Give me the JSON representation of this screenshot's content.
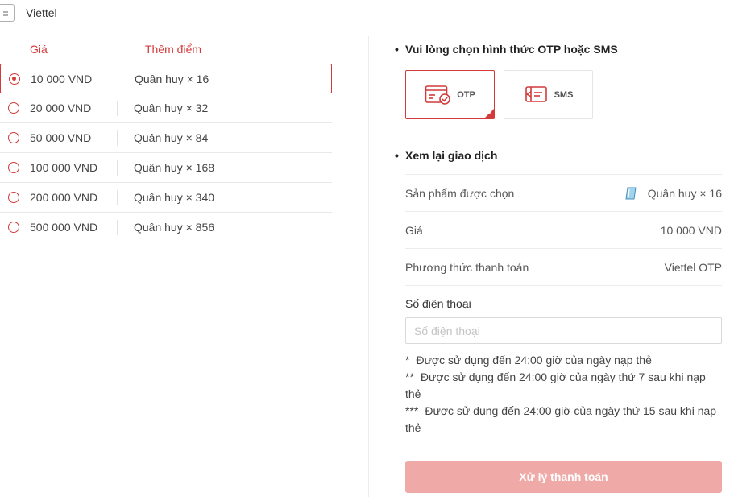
{
  "provider": {
    "name": "Viettel",
    "icon": "document-icon"
  },
  "columns": {
    "price": "Giá",
    "points": "Thêm điểm"
  },
  "options": [
    {
      "price": "10 000 VND",
      "points": "Quân huy × 16",
      "selected": true
    },
    {
      "price": "20 000 VND",
      "points": "Quân huy × 32",
      "selected": false
    },
    {
      "price": "50 000 VND",
      "points": "Quân huy × 84",
      "selected": false
    },
    {
      "price": "100 000 VND",
      "points": "Quân huy × 168",
      "selected": false
    },
    {
      "price": "200 000 VND",
      "points": "Quân huy × 340",
      "selected": false
    },
    {
      "price": "500 000 VND",
      "points": "Quân huy × 856",
      "selected": false
    }
  ],
  "otp_section": {
    "bullet": "•",
    "title": "Vui lòng chọn hình thức OTP hoặc SMS",
    "methods": [
      {
        "label": "OTP",
        "icon": "otp-card-icon",
        "active": true
      },
      {
        "label": "SMS",
        "icon": "sms-card-icon",
        "active": false
      }
    ]
  },
  "review_section": {
    "bullet": "•",
    "title": "Xem lại giao dịch",
    "rows": [
      {
        "label": "Sản phẩm được chọn",
        "value": "Quân huy × 16",
        "icon": "gem-icon"
      },
      {
        "label": "Giá",
        "value": "10 000 VND"
      },
      {
        "label": "Phương thức thanh toán",
        "value": "Viettel OTP"
      }
    ]
  },
  "phone": {
    "label": "Số điện thoại",
    "placeholder": "Số điện thoại",
    "value": ""
  },
  "notes": [
    {
      "mark": "*",
      "text": "Được sử dụng đến 24:00 giờ của ngày nạp thẻ"
    },
    {
      "mark": "**",
      "text": "Được sử dụng đến 24:00 giờ của ngày thứ 7 sau khi nạp thẻ"
    },
    {
      "mark": "***",
      "text": "Được sử dụng đến 24:00 giờ của ngày thứ 15 sau khi nạp thẻ"
    }
  ],
  "submit": {
    "label": "Xử lý thanh toán"
  },
  "colors": {
    "accent": "#d33a3a",
    "button_disabled": "#efaaa8",
    "divider": "#e8e8e8"
  }
}
